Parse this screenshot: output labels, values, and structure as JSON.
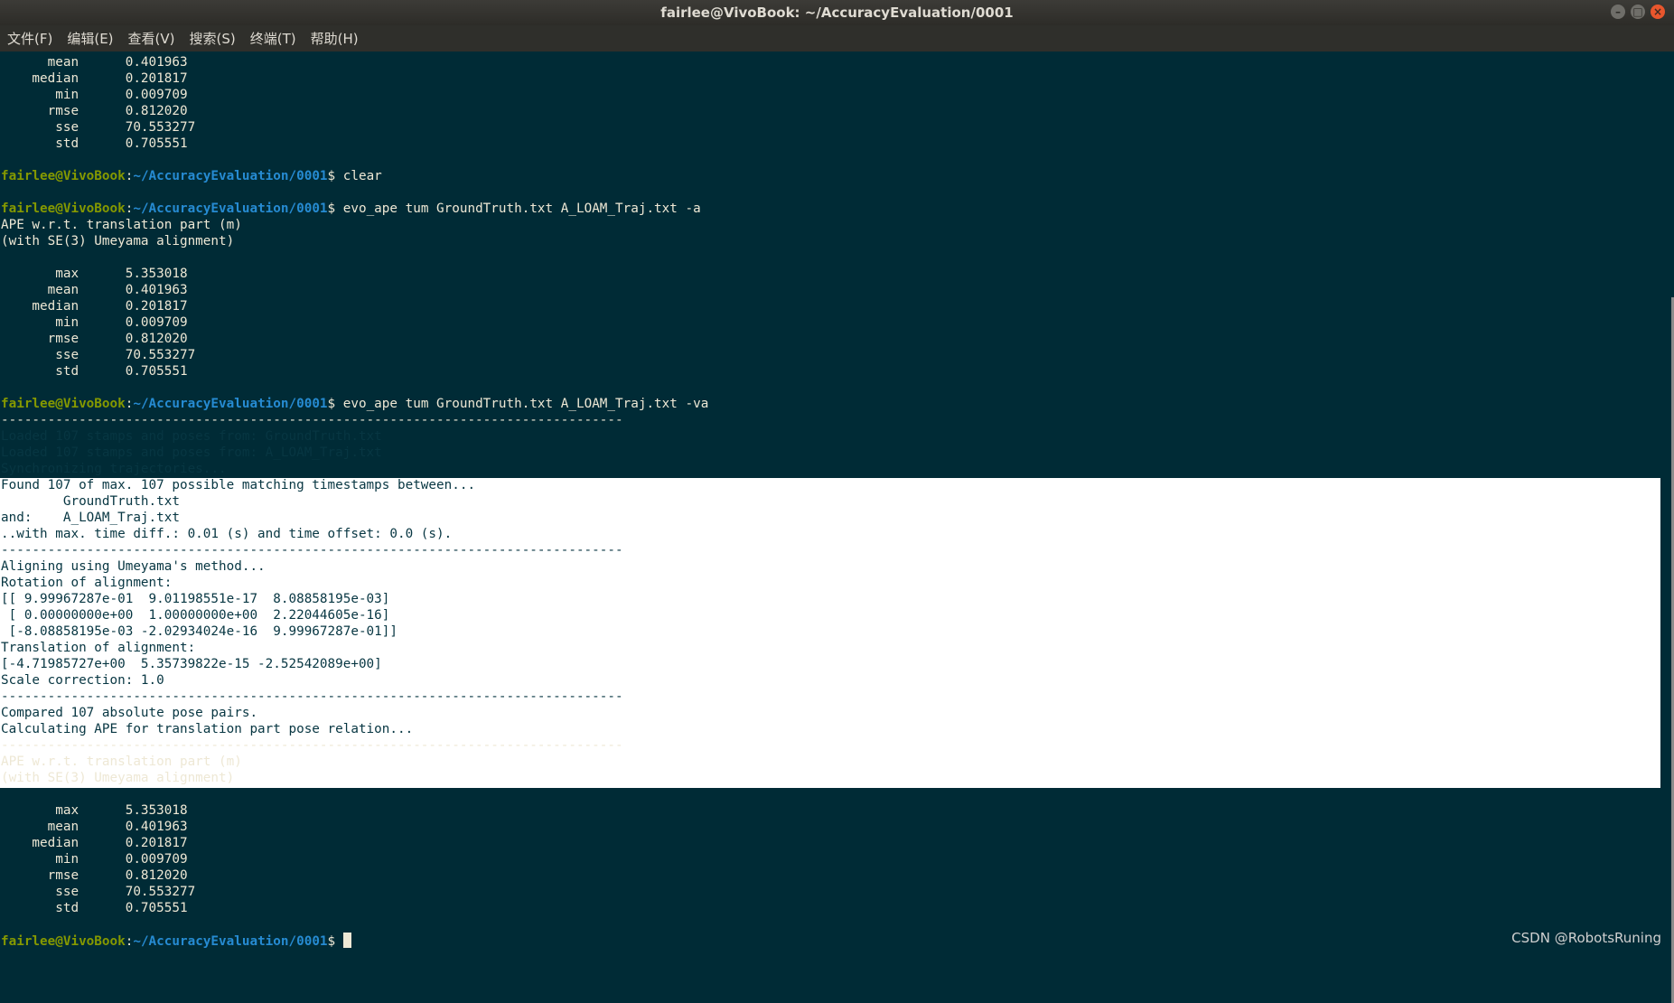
{
  "window": {
    "title": "fairlee@VivoBook: ~/AccuracyEvaluation/0001"
  },
  "menu": [
    "文件(F)",
    "编辑(E)",
    "查看(V)",
    "搜索(S)",
    "终端(T)",
    "帮助(H)"
  ],
  "prompt": {
    "user_host": "fairlee@VivoBook",
    "path": "~/AccuracyEvaluation/0001"
  },
  "terminal": {
    "lines": [
      {
        "t": "      mean      0.401963"
      },
      {
        "t": "    median      0.201817"
      },
      {
        "t": "       min      0.009709"
      },
      {
        "t": "      rmse      0.812020"
      },
      {
        "t": "       sse      70.553277"
      },
      {
        "t": "       std      0.705551"
      },
      {
        "t": ""
      },
      {
        "cmd": "clear"
      },
      {
        "t": ""
      },
      {
        "cmd": "evo_ape tum GroundTruth.txt A_LOAM_Traj.txt -a"
      },
      {
        "t": "APE w.r.t. translation part (m)"
      },
      {
        "t": "(with SE(3) Umeyama alignment)"
      },
      {
        "t": ""
      },
      {
        "t": "       max      5.353018"
      },
      {
        "t": "      mean      0.401963"
      },
      {
        "t": "    median      0.201817"
      },
      {
        "t": "       min      0.009709"
      },
      {
        "t": "      rmse      0.812020"
      },
      {
        "t": "       sse      70.553277"
      },
      {
        "t": "       std      0.705551"
      },
      {
        "t": ""
      },
      {
        "cmd": "evo_ape tum GroundTruth.txt A_LOAM_Traj.txt -va"
      },
      {
        "t": "--------------------------------------------------------------------------------"
      },
      {
        "t": "Loaded 107 stamps and poses from: GroundTruth.txt",
        "sel": true
      },
      {
        "t": "Loaded 107 stamps and poses from: A_LOAM_Traj.txt",
        "sel": true
      },
      {
        "t": "Synchronizing trajectories...",
        "sel": true
      },
      {
        "t": "Found 107 of max. 107 possible matching timestamps between...",
        "sel": true
      },
      {
        "t": "        GroundTruth.txt",
        "sel": true
      },
      {
        "t": "and:    A_LOAM_Traj.txt",
        "sel": true
      },
      {
        "t": "..with max. time diff.: 0.01 (s) and time offset: 0.0 (s).",
        "sel": true
      },
      {
        "t": "--------------------------------------------------------------------------------",
        "sel": true
      },
      {
        "t": "Aligning using Umeyama's method...",
        "sel": true
      },
      {
        "t": "Rotation of alignment:",
        "sel": true
      },
      {
        "t": "[[ 9.99967287e-01  9.01198551e-17  8.08858195e-03]",
        "sel": true
      },
      {
        "t": " [ 0.00000000e+00  1.00000000e+00  2.22044605e-16]",
        "sel": true
      },
      {
        "t": " [-8.08858195e-03 -2.02934024e-16  9.99967287e-01]]",
        "sel": true
      },
      {
        "t": "Translation of alignment:",
        "sel": true
      },
      {
        "t": "[-4.71985727e+00  5.35739822e-15 -2.52542089e+00]",
        "sel": true
      },
      {
        "t": "Scale correction: 1.0",
        "sel": true
      },
      {
        "t": "--------------------------------------------------------------------------------",
        "sel": true
      },
      {
        "t": "Compared 107 absolute pose pairs.",
        "sel": true
      },
      {
        "t": "Calculating APE for translation part pose relation...",
        "sel": true
      },
      {
        "t": "--------------------------------------------------------------------------------"
      },
      {
        "t": "APE w.r.t. translation part (m)"
      },
      {
        "t": "(with SE(3) Umeyama alignment)"
      },
      {
        "t": ""
      },
      {
        "t": "       max      5.353018"
      },
      {
        "t": "      mean      0.401963"
      },
      {
        "t": "    median      0.201817"
      },
      {
        "t": "       min      0.009709"
      },
      {
        "t": "      rmse      0.812020"
      },
      {
        "t": "       sse      70.553277"
      },
      {
        "t": "       std      0.705551"
      },
      {
        "t": ""
      },
      {
        "cmd": "",
        "cursor": true
      }
    ]
  },
  "watermark": "CSDN @RobotsRuning"
}
